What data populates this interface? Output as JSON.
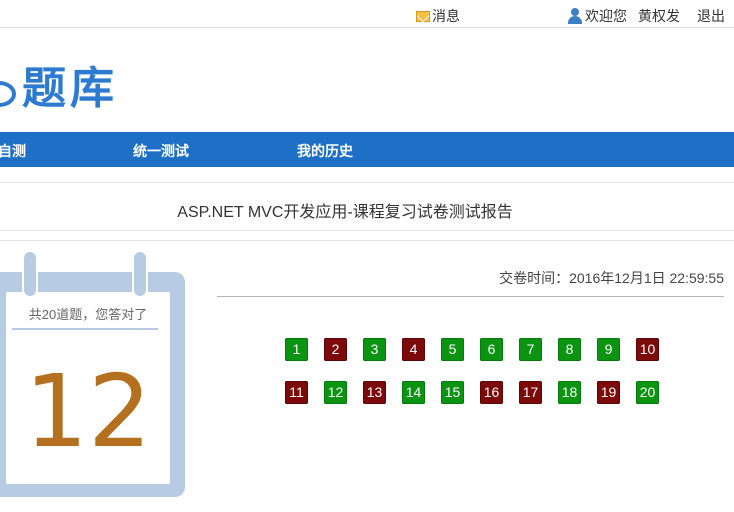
{
  "topbar": {
    "messages_label": "消息",
    "welcome_label": "欢迎您",
    "username": "黄权发",
    "logout_label": "退出"
  },
  "logo": {
    "text": "题库"
  },
  "nav": {
    "items": [
      {
        "label": "自测"
      },
      {
        "label": "统一测试"
      },
      {
        "label": "我的历史"
      }
    ]
  },
  "report": {
    "title": "ASP.NET MVC开发应用-课程复习试卷测试报告",
    "summary": "共20道题，您答对了",
    "score": "12",
    "submit_time": "交卷时间：2016年12月1日 22:59:55"
  },
  "answers": [
    {
      "num": "1",
      "status": "correct"
    },
    {
      "num": "2",
      "status": "wrong"
    },
    {
      "num": "3",
      "status": "correct"
    },
    {
      "num": "4",
      "status": "wrong"
    },
    {
      "num": "5",
      "status": "correct"
    },
    {
      "num": "6",
      "status": "correct"
    },
    {
      "num": "7",
      "status": "correct"
    },
    {
      "num": "8",
      "status": "correct"
    },
    {
      "num": "9",
      "status": "correct"
    },
    {
      "num": "10",
      "status": "wrong"
    },
    {
      "num": "11",
      "status": "wrong"
    },
    {
      "num": "12",
      "status": "correct"
    },
    {
      "num": "13",
      "status": "wrong"
    },
    {
      "num": "14",
      "status": "correct"
    },
    {
      "num": "15",
      "status": "correct"
    },
    {
      "num": "16",
      "status": "wrong"
    },
    {
      "num": "17",
      "status": "wrong"
    },
    {
      "num": "18",
      "status": "correct"
    },
    {
      "num": "19",
      "status": "wrong"
    },
    {
      "num": "20",
      "status": "correct"
    }
  ],
  "colors": {
    "nav_blue": "#1e6fc6",
    "correct_green": "#0b9412",
    "wrong_red": "#7c0a0a",
    "score_gold": "#b5701f"
  }
}
